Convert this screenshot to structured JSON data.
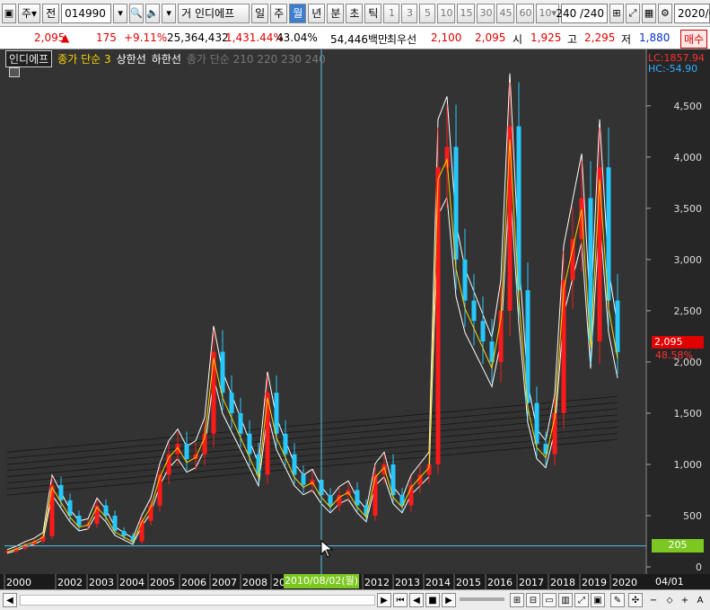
{
  "toolbar": {
    "market": "주",
    "prefix": "전",
    "code": "014990",
    "sound_icon": "speaker-icon",
    "name_prefix": "거",
    "name": "인디에프",
    "periods": [
      "일",
      "주",
      "월",
      "년",
      "분",
      "초",
      "틱"
    ],
    "active_period": "월",
    "intervals": [
      "1",
      "3",
      "5",
      "10",
      "15",
      "30",
      "45",
      "60"
    ],
    "count_select": "10",
    "range_text": "240 /240",
    "date_text": "2020/0"
  },
  "quote": {
    "price": "2,095",
    "up_mark": "▲",
    "change": "175",
    "change_pct": "+9.11%",
    "volume": "25,364,432",
    "volume_ratio": "1,431.44%",
    "turnover": "43.04%",
    "amount": "54,446백만",
    "best_label": "최우선",
    "best_value": "2,100",
    "bid_value": "2,095",
    "open_label": "시",
    "open": "1,925",
    "high_label": "고",
    "high": "2,295",
    "low_label": "저",
    "low": "1,880",
    "buy_label": "매수"
  },
  "legend": {
    "name": "인디에프",
    "ma_label": "종가 단순 3",
    "upper": "상한선",
    "lower": "하한선",
    "extra": "종가 단순 210 220 230 240"
  },
  "axis": {
    "lc": "LC:1857.94",
    "hc": "HC:-54.90",
    "current": "2,095",
    "current_pct": "48.58%",
    "crosshair_value": "205",
    "crosshair_date": "2010/08/02(월)",
    "right_date": "04/01"
  },
  "chart_data": {
    "type": "candlestick",
    "y_ticks": [
      "4,500",
      "4,000",
      "3,500",
      "3,000",
      "2,500",
      "2,000",
      "1,500",
      "1,000",
      "500",
      "0"
    ],
    "ylim": [
      0,
      4700
    ],
    "x_ticks": [
      "2000",
      "2002",
      "2003",
      "2004",
      "2005",
      "2006",
      "2007",
      "2008",
      "20",
      "2012",
      "2013",
      "2014",
      "2015",
      "2016",
      "2017",
      "2018",
      "2019",
      "2020"
    ],
    "series": [
      {
        "name": "인디에프",
        "values": [
          150,
          180,
          220,
          250,
          300,
          800,
          650,
          500,
          400,
          420,
          600,
          500,
          350,
          300,
          250,
          450,
          600,
          900,
          1100,
          1200,
          1050,
          1100,
          1300,
          2100,
          1700,
          1500,
          1300,
          1100,
          900,
          1700,
          1300,
          1100,
          900,
          800,
          850,
          700,
          600,
          700,
          750,
          600,
          500,
          900,
          1000,
          700,
          600,
          800,
          900,
          1000,
          3900,
          4100,
          3000,
          2600,
          2400,
          2200,
          2000,
          2500,
          4300,
          2700,
          1600,
          1200,
          1100,
          1500,
          2800,
          3200,
          3600,
          2200,
          3900,
          2600,
          2095
        ]
      }
    ]
  },
  "scroll": {
    "buttons": [
      "◀",
      "▶",
      "⏮",
      "◀",
      "■",
      "▶"
    ]
  }
}
